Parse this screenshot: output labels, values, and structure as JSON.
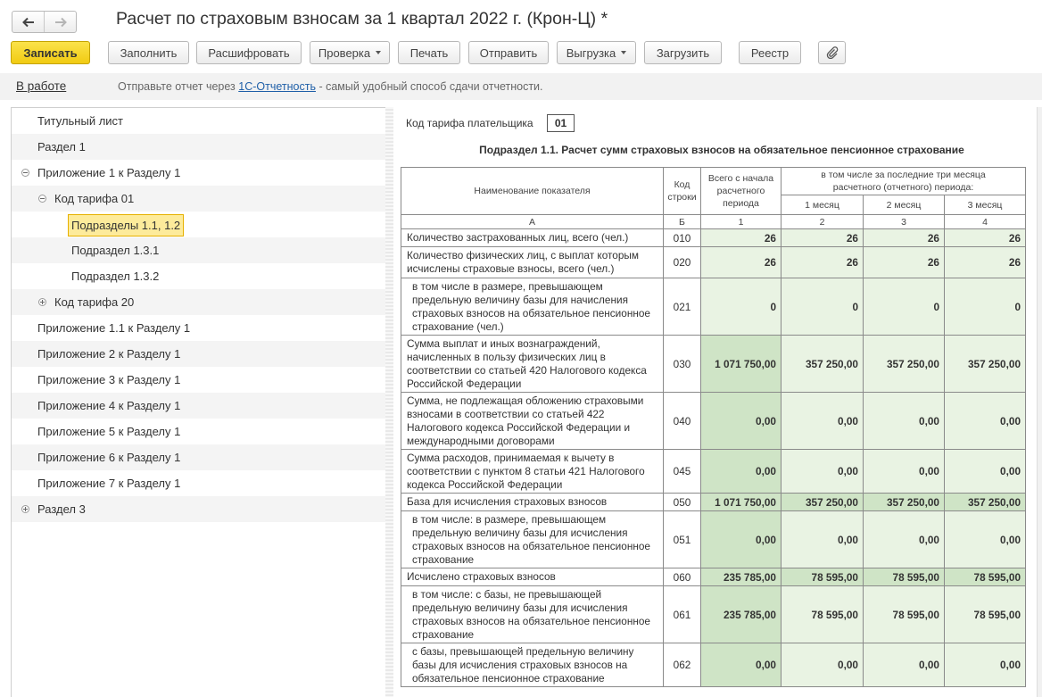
{
  "window": {
    "title": "Расчет по страховым взносам за 1 квартал 2022 г. (Крон-Ц) *",
    "nav": [
      {
        "name": "back-arrow-icon"
      },
      {
        "name": "forward-arrow-icon"
      }
    ]
  },
  "toolbar": {
    "save": "Записать",
    "fill": "Заполнить",
    "decode": "Расшифровать",
    "check": "Проверка",
    "print": "Печать",
    "send": "Отправить",
    "export": "Выгрузка",
    "import": "Загрузить",
    "registry": "Реестр",
    "attach_icon": "paperclip-icon"
  },
  "status": {
    "state": "В работе",
    "hint_before": "Отправьте отчет через ",
    "hint_link": "1С-Отчетность",
    "hint_after": " - самый удобный способ сдачи отчетности."
  },
  "tree": {
    "items": [
      {
        "label": "Титульный лист"
      },
      {
        "label": "Раздел 1"
      },
      {
        "label": "Приложение 1 к Разделу 1"
      },
      {
        "label": "Код тарифа 01"
      },
      {
        "label": "Подразделы 1.1, 1.2"
      },
      {
        "label": "Подраздел 1.3.1"
      },
      {
        "label": "Подраздел 1.3.2"
      },
      {
        "label": "Код тарифа 20"
      },
      {
        "label": "Приложение 1.1 к Разделу 1"
      },
      {
        "label": "Приложение 2 к Разделу 1"
      },
      {
        "label": "Приложение 3 к Разделу 1"
      },
      {
        "label": "Приложение 4 к Разделу 1"
      },
      {
        "label": "Приложение 5 к Разделу 1"
      },
      {
        "label": "Приложение 6 к Разделу 1"
      },
      {
        "label": "Приложение 7 к Разделу 1"
      },
      {
        "label": "Раздел 3"
      }
    ]
  },
  "report": {
    "tariff_label": "Код тарифа плательщика",
    "tariff_code": "01",
    "subtitle": "Подраздел 1.1. Расчет сумм страховых взносов на обязательное пенсионное страхование",
    "headers": {
      "name": "Наименование показателя",
      "code": "Код строки",
      "total": "Всего с начала расчетного периода",
      "last3_line1": "в том числе за последние три месяца",
      "last3_line2": "расчетного (отчетного) периода:",
      "m1": "1 месяц",
      "m2": "2 месяц",
      "m3": "3 месяц",
      "colA": "А",
      "colB": "Б",
      "col1": "1",
      "col2": "2",
      "col3": "3",
      "col4": "4"
    },
    "rows": [
      {
        "name": "Количество застрахованных лиц, всего (чел.)",
        "code": "010",
        "total": "26",
        "m1": "26",
        "m2": "26",
        "m3": "26"
      },
      {
        "name": "Количество физических лиц, с выплат которым исчислены страховые взносы, всего (чел.)",
        "code": "020",
        "total": "26",
        "m1": "26",
        "m2": "26",
        "m3": "26"
      },
      {
        "name": "в том числе в размере, превышающем предельную величину базы для начисления страховых взносов на обязательное пенсионное страхование (чел.)",
        "code": "021",
        "total": "0",
        "m1": "0",
        "m2": "0",
        "m3": "0"
      },
      {
        "name": "Сумма выплат и иных вознаграждений, начисленных в пользу физических лиц в соответствии со статьей 420 Налогового кодекса Российской Федерации",
        "code": "030",
        "total": "1 071 750,00",
        "m1": "357 250,00",
        "m2": "357 250,00",
        "m3": "357 250,00"
      },
      {
        "name": "Сумма, не подлежащая обложению страховыми взносами в соответствии со статьей 422 Налогового кодекса Российской Федерации и международными договорами",
        "code": "040",
        "total": "0,00",
        "m1": "0,00",
        "m2": "0,00",
        "m3": "0,00"
      },
      {
        "name": "Сумма расходов, принимаемая к вычету в соответствии с пунктом 8 статьи 421 Налогового кодекса Российской Федерации",
        "code": "045",
        "total": "0,00",
        "m1": "0,00",
        "m2": "0,00",
        "m3": "0,00"
      },
      {
        "name": "База для исчисления страховых взносов",
        "code": "050",
        "total": "1 071 750,00",
        "m1": "357 250,00",
        "m2": "357 250,00",
        "m3": "357 250,00"
      },
      {
        "name": "в том числе: в размере, превышающем предельную величину базы для исчисления страховых взносов на обязательное пенсионное страхование",
        "code": "051",
        "total": "0,00",
        "m1": "0,00",
        "m2": "0,00",
        "m3": "0,00"
      },
      {
        "name": "Исчислено страховых взносов",
        "code": "060",
        "total": "235 785,00",
        "m1": "78 595,00",
        "m2": "78 595,00",
        "m3": "78 595,00"
      },
      {
        "name": "в том числе: с базы, не превышающей предельную величину базы для исчисления страховых взносов на обязательное пенсионное страхование",
        "code": "061",
        "total": "235 785,00",
        "m1": "78 595,00",
        "m2": "78 595,00",
        "m3": "78 595,00"
      },
      {
        "name": "с базы, превышающей предельную величину базы для исчисления страховых взносов на обязательное пенсионное страхование",
        "code": "062",
        "total": "0,00",
        "m1": "0,00",
        "m2": "0,00",
        "m3": "0,00"
      }
    ]
  }
}
